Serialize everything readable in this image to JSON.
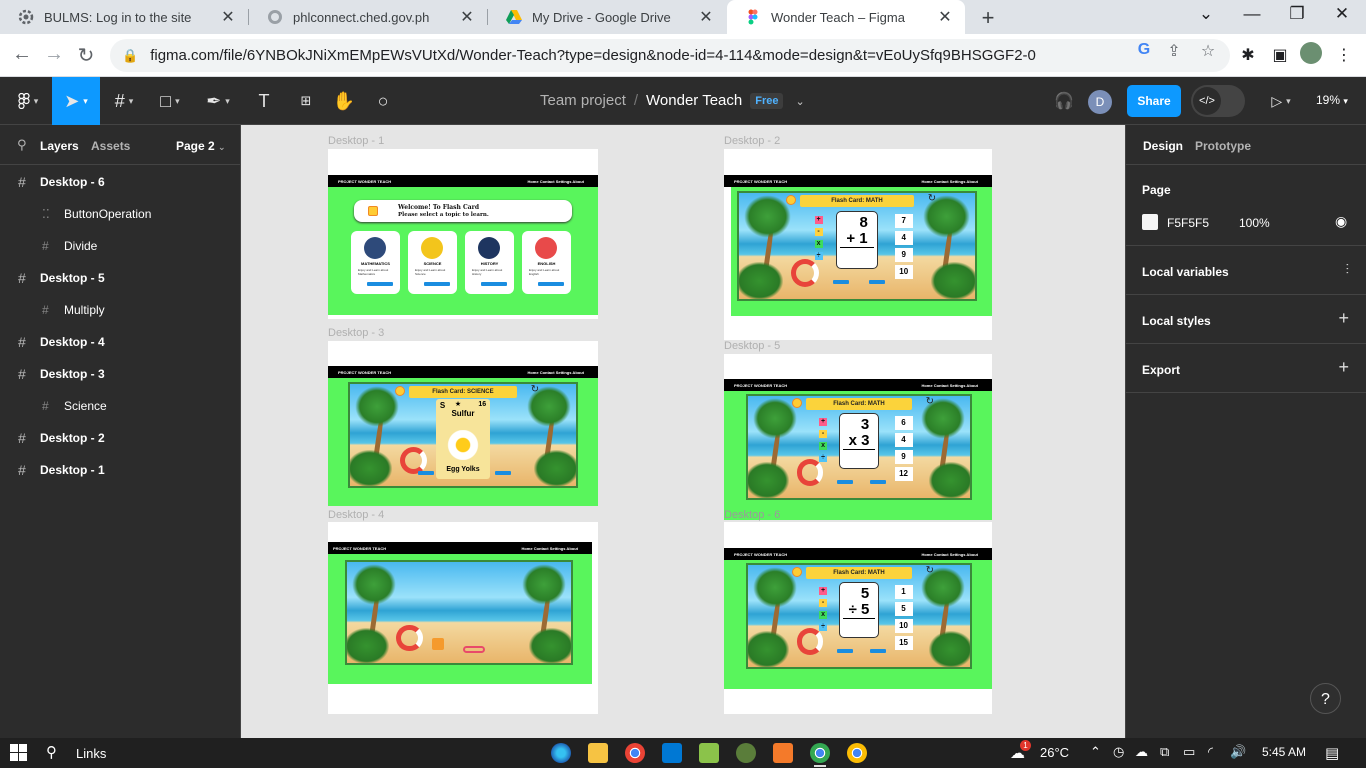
{
  "browser": {
    "tabs": [
      {
        "title": "BULMS: Log in to the site",
        "icon": "gear-favicon",
        "active": false
      },
      {
        "title": "phlconnect.ched.gov.ph",
        "icon": "globe-favicon",
        "active": false
      },
      {
        "title": "My Drive - Google Drive",
        "icon": "google-drive-favicon",
        "active": false
      },
      {
        "title": "Wonder Teach – Figma",
        "icon": "figma-favicon",
        "active": true
      }
    ],
    "url": "figma.com/file/6YNBOkJNiXmEMpEWsVUtXd/Wonder-Teach?type=design&node-id=4-114&mode=design&t=vEoUySfq9BHSGGF2-0"
  },
  "figma": {
    "toolbar": {
      "team": "Team project",
      "file": "Wonder Teach",
      "plan": "Free",
      "avatar": "D",
      "share_label": "Share",
      "zoom": "19%"
    },
    "left_panel": {
      "tab_layers": "Layers",
      "tab_assets": "Assets",
      "page": "Page 2",
      "layers": [
        {
          "name": "Desktop - 6",
          "child": false,
          "icon": "frame-icon"
        },
        {
          "name": "ButtonOperation",
          "child": true,
          "icon": "component-icon"
        },
        {
          "name": "Divide",
          "child": true,
          "icon": "frame-icon"
        },
        {
          "name": "Desktop - 5",
          "child": false,
          "icon": "frame-icon"
        },
        {
          "name": "Multiply",
          "child": true,
          "icon": "frame-icon"
        },
        {
          "name": "Desktop - 4",
          "child": false,
          "icon": "frame-icon"
        },
        {
          "name": "Desktop - 3",
          "child": false,
          "icon": "frame-icon"
        },
        {
          "name": "Science",
          "child": true,
          "icon": "frame-icon"
        },
        {
          "name": "Desktop - 2",
          "child": false,
          "icon": "frame-icon"
        },
        {
          "name": "Desktop - 1",
          "child": false,
          "icon": "frame-icon"
        }
      ]
    },
    "canvas": {
      "frame_labels": [
        "Desktop - 1",
        "Desktop - 2",
        "Desktop - 3",
        "Desktop - 5",
        "Desktop - 4",
        "Desktop - 6"
      ],
      "nav_brand": "PROJECT WONDER TEACH",
      "nav_links": "Home   Contact   Settings   About",
      "desktop1": {
        "welcome_title": "Welcome! To Flash Card",
        "welcome_sub": "Please select a topic to learn.",
        "topics": [
          {
            "name": "MATHEMATICS",
            "desc": "Enjoy and Learn about Mathematics",
            "color": "#2e4a7a"
          },
          {
            "name": "SCIENCE",
            "desc": "Enjoy and Learn about Science",
            "color": "#f3c51c"
          },
          {
            "name": "HISTORY",
            "desc": "Enjoy and Learn about History",
            "color": "#1e3560"
          },
          {
            "name": "ENGLISH",
            "desc": "Enjoy and Learn about English",
            "color": "#e84a4a"
          }
        ]
      },
      "desktop2": {
        "header": "Flash Card: MATH",
        "top": "8",
        "bottom": "+ 1",
        "answers": [
          "7",
          "4",
          "9",
          "10"
        ]
      },
      "desktop3": {
        "header": "Flash Card: SCIENCE",
        "symbol": "S",
        "number": "16",
        "element": "Sulfur",
        "caption": "Egg Yolks"
      },
      "desktop5": {
        "header": "Flash Card: MATH",
        "top": "3",
        "bottom": "x 3",
        "answers": [
          "6",
          "4",
          "9",
          "12"
        ]
      },
      "desktop6": {
        "header": "Flash Card: MATH",
        "top": "5",
        "bottom": "÷ 5",
        "answers": [
          "1",
          "5",
          "10",
          "15"
        ]
      },
      "operators": [
        "+",
        "-",
        "x",
        "÷"
      ],
      "operator_colors": [
        "#ff5c8a",
        "#ffd23f",
        "#3ddc5c",
        "#4fc3f7"
      ]
    },
    "right_panel": {
      "tab_design": "Design",
      "tab_prototype": "Prototype",
      "page_label": "Page",
      "page_color": "F5F5F5",
      "page_opacity": "100%",
      "local_variables": "Local variables",
      "local_styles": "Local styles",
      "export": "Export"
    }
  },
  "taskbar": {
    "search_label": "Links",
    "weather": "26°C",
    "time": "5:45 AM",
    "notification_count": "1"
  }
}
